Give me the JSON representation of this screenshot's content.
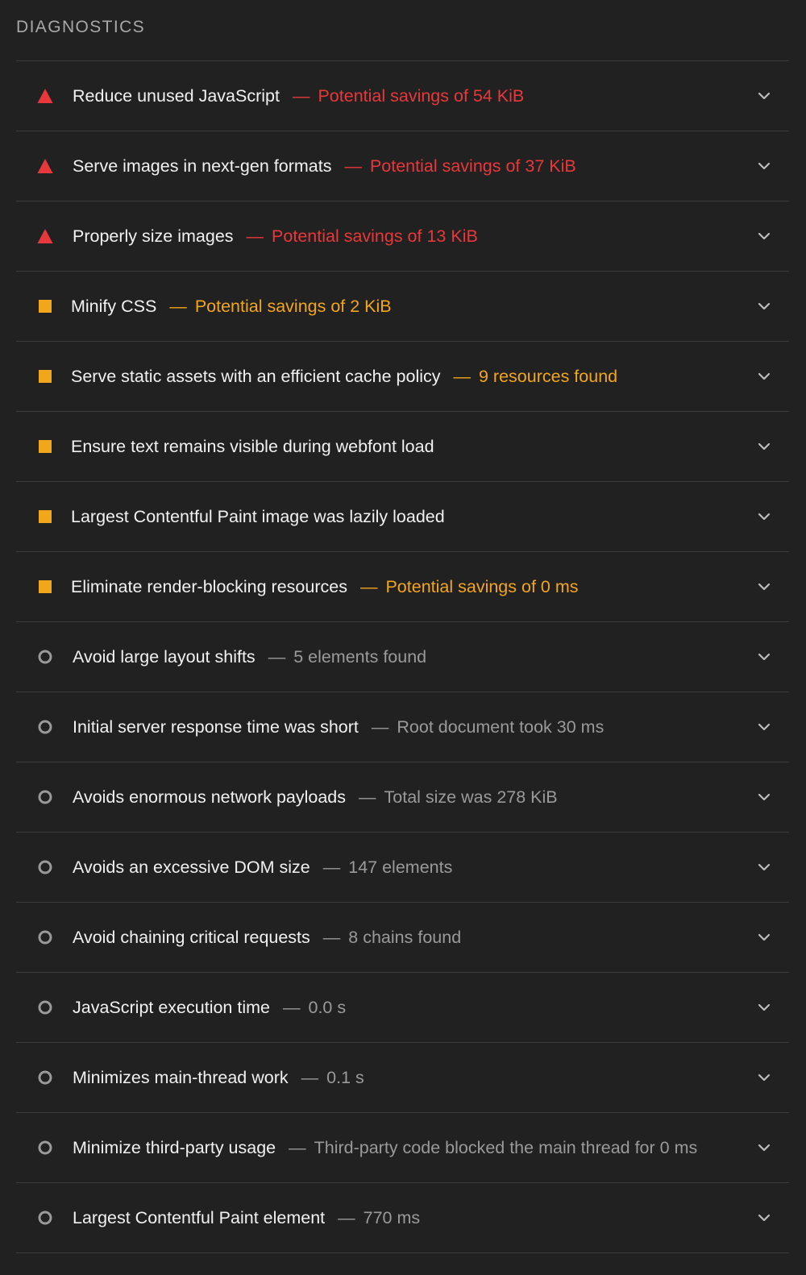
{
  "section": {
    "title": "DIAGNOSTICS"
  },
  "colors": {
    "background": "#212121",
    "fail": "#e8383b",
    "warn": "#f2a61a",
    "info": "#9a9a9a",
    "title_text": "#f1f1f1",
    "divider": "#3c3c3c"
  },
  "audits": [
    {
      "severity": "fail",
      "icon": "red-triangle-icon",
      "title": "Reduce unused JavaScript",
      "separator": "—",
      "detail": "Potential savings of 54 KiB"
    },
    {
      "severity": "fail",
      "icon": "red-triangle-icon",
      "title": "Serve images in next-gen formats",
      "separator": "—",
      "detail": "Potential savings of 37 KiB"
    },
    {
      "severity": "fail",
      "icon": "red-triangle-icon",
      "title": "Properly size images",
      "separator": "—",
      "detail": "Potential savings of 13 KiB"
    },
    {
      "severity": "warn",
      "icon": "orange-square-icon",
      "title": "Minify CSS",
      "separator": "—",
      "detail": "Potential savings of 2 KiB"
    },
    {
      "severity": "warn",
      "icon": "orange-square-icon",
      "title": "Serve static assets with an efficient cache policy",
      "separator": "—",
      "detail": "9 resources found"
    },
    {
      "severity": "warn",
      "icon": "orange-square-icon",
      "title": "Ensure text remains visible during webfont load",
      "separator": "",
      "detail": ""
    },
    {
      "severity": "warn",
      "icon": "orange-square-icon",
      "title": "Largest Contentful Paint image was lazily loaded",
      "separator": "",
      "detail": ""
    },
    {
      "severity": "warn",
      "icon": "orange-square-icon",
      "title": "Eliminate render-blocking resources",
      "separator": "—",
      "detail": "Potential savings of 0 ms"
    },
    {
      "severity": "info",
      "icon": "gray-circle-icon",
      "title": "Avoid large layout shifts",
      "separator": "—",
      "detail": "5 elements found"
    },
    {
      "severity": "info",
      "icon": "gray-circle-icon",
      "title": "Initial server response time was short",
      "separator": "—",
      "detail": "Root document took 30 ms"
    },
    {
      "severity": "info",
      "icon": "gray-circle-icon",
      "title": "Avoids enormous network payloads",
      "separator": "—",
      "detail": "Total size was 278 KiB"
    },
    {
      "severity": "info",
      "icon": "gray-circle-icon",
      "title": "Avoids an excessive DOM size",
      "separator": "—",
      "detail": "147 elements"
    },
    {
      "severity": "info",
      "icon": "gray-circle-icon",
      "title": "Avoid chaining critical requests",
      "separator": "—",
      "detail": "8 chains found"
    },
    {
      "severity": "info",
      "icon": "gray-circle-icon",
      "title": "JavaScript execution time",
      "separator": "—",
      "detail": "0.0 s"
    },
    {
      "severity": "info",
      "icon": "gray-circle-icon",
      "title": "Minimizes main-thread work",
      "separator": "—",
      "detail": "0.1 s"
    },
    {
      "severity": "info",
      "icon": "gray-circle-icon",
      "title": "Minimize third-party usage",
      "separator": "—",
      "detail": "Third-party code blocked the main thread for 0 ms"
    },
    {
      "severity": "info",
      "icon": "gray-circle-icon",
      "title": "Largest Contentful Paint element",
      "separator": "—",
      "detail": "770 ms"
    }
  ]
}
